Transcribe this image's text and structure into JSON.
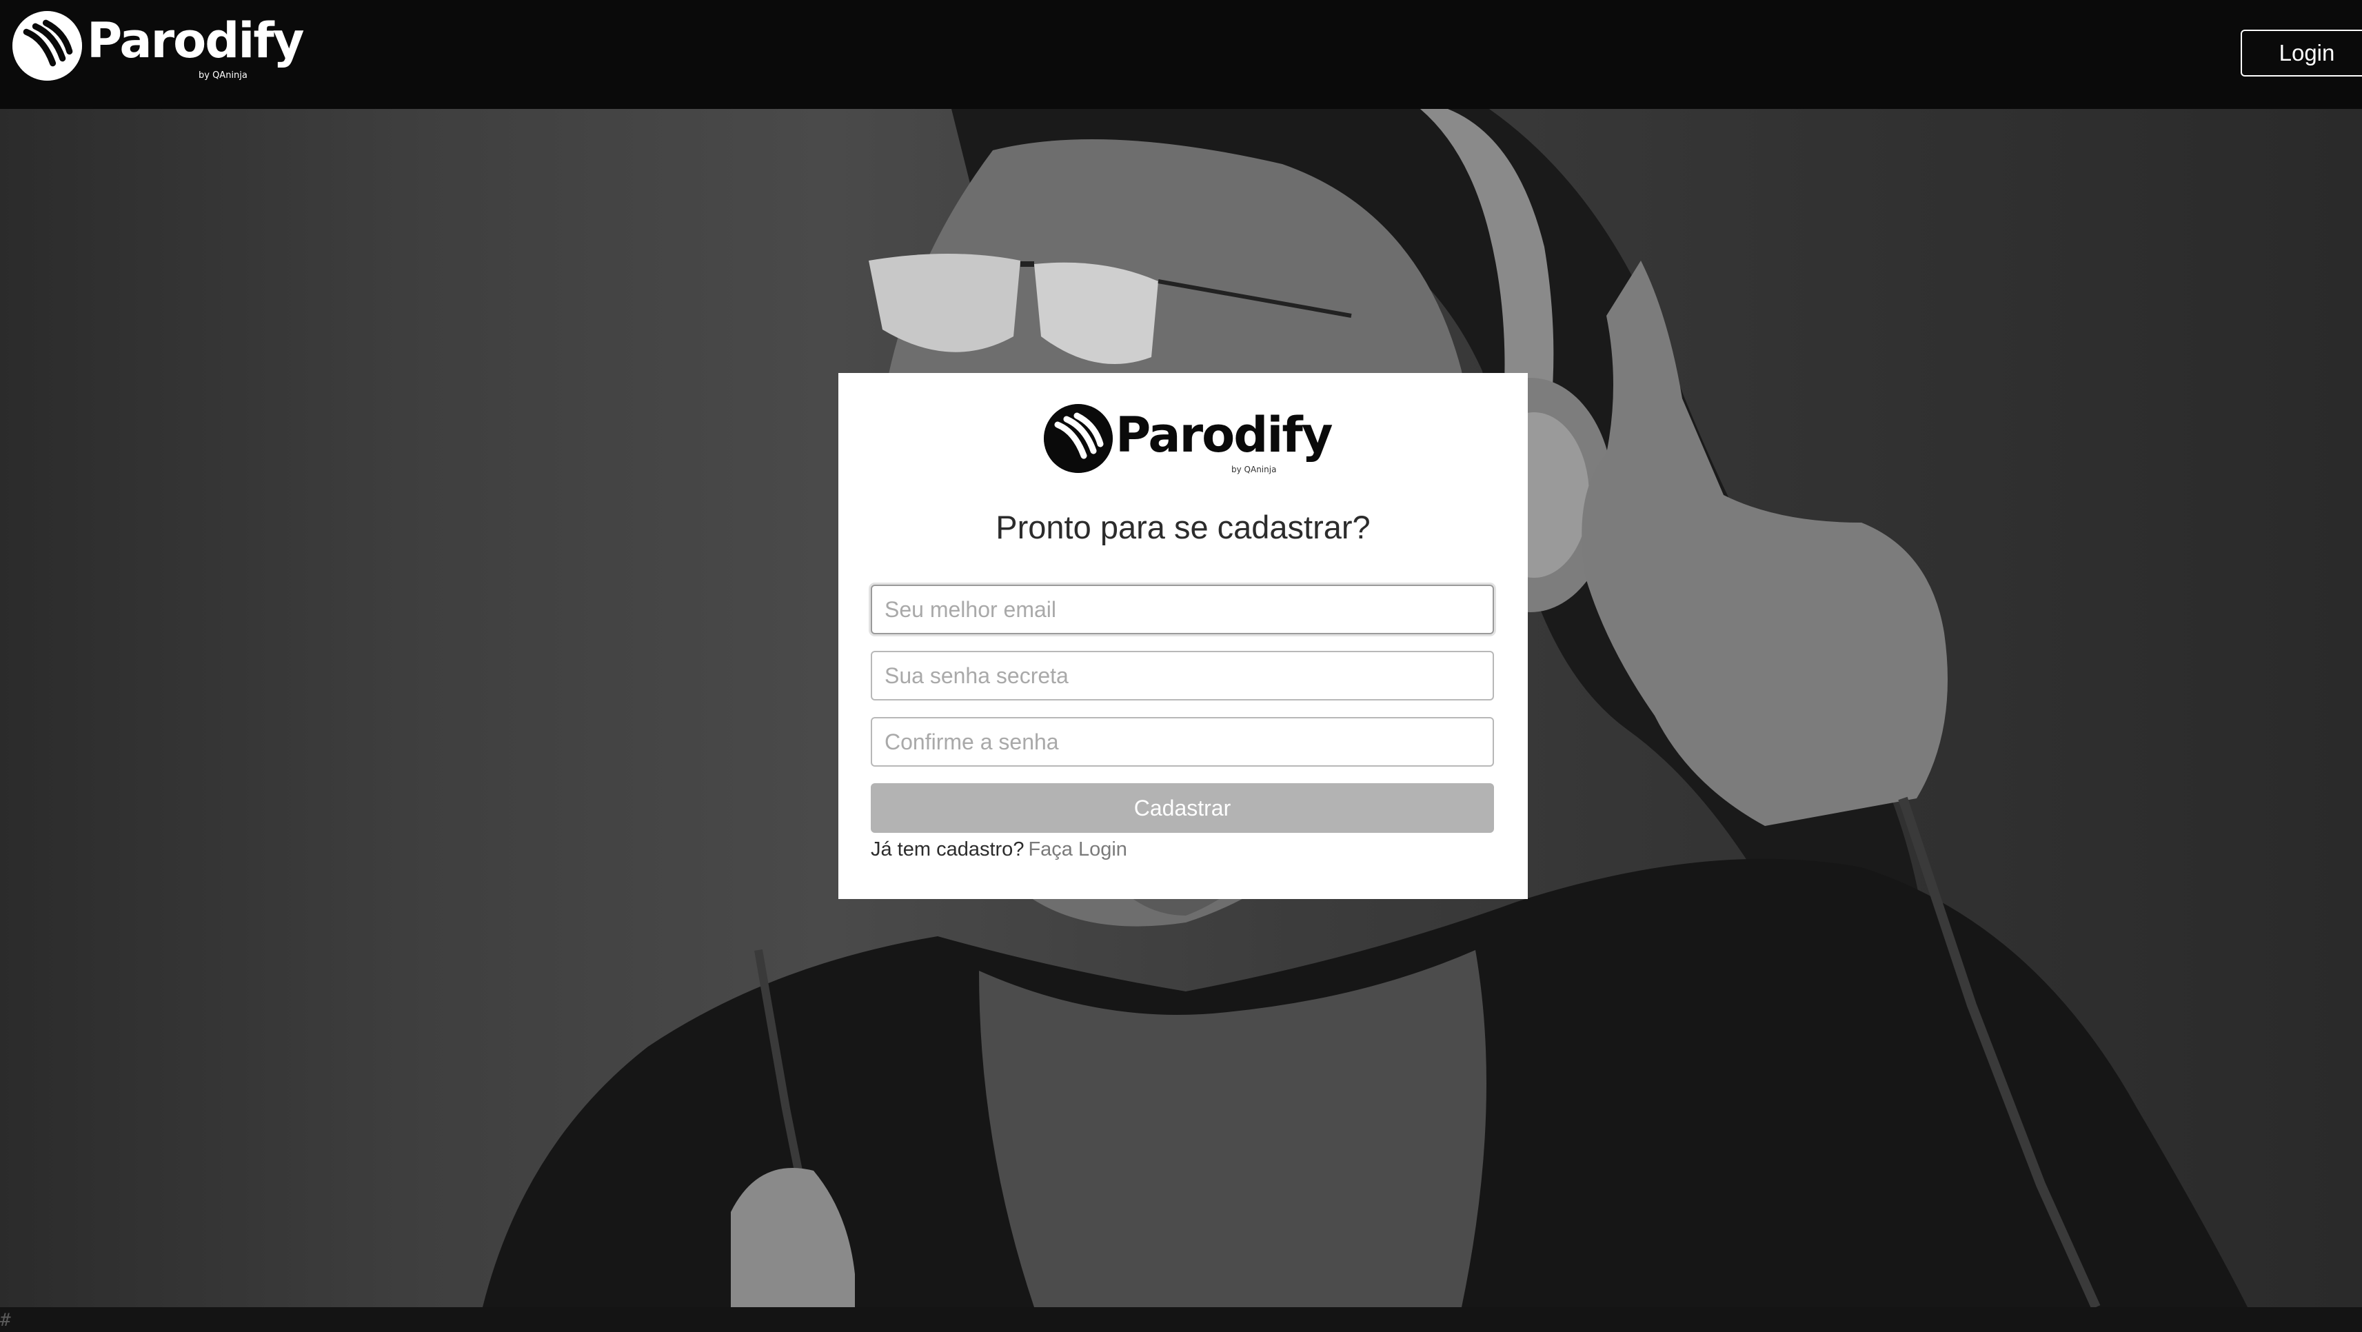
{
  "app": {
    "brand_name": "Parodify",
    "brand_byline": "by QAninja"
  },
  "header": {
    "login_label": "Login"
  },
  "signup": {
    "title": "Pronto para se cadastrar?",
    "email_placeholder": "Seu melhor email",
    "password_placeholder": "Sua senha secreta",
    "confirm_placeholder": "Confirme a senha",
    "email_value": "",
    "password_value": "",
    "confirm_value": "",
    "submit_label": "Cadastrar",
    "already_text": "Já tem cadastro?",
    "login_link": "Faça Login"
  },
  "footer": {
    "hash": "#"
  },
  "icons": {
    "brand": "parodify-logo-icon",
    "background": "woman-with-headphones-photo"
  },
  "colors": {
    "topbar": "#0a0a0a",
    "card": "#ffffff",
    "submit_disabled": "#b3b3b3",
    "link": "#7a7a7a"
  }
}
